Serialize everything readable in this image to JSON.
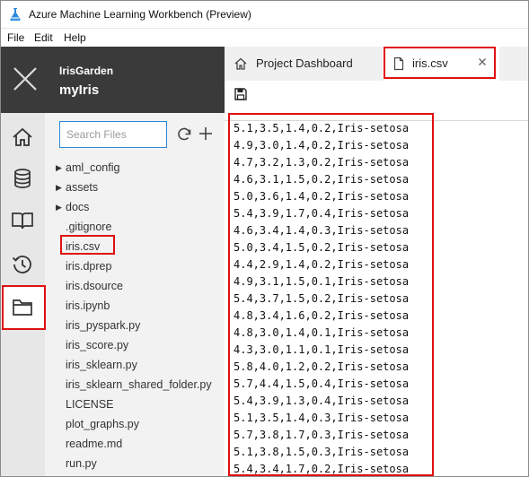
{
  "window": {
    "title": "Azure Machine Learning Workbench (Preview)",
    "app_icon": "flask-icon"
  },
  "menubar": {
    "items": [
      {
        "label": "File"
      },
      {
        "label": "Edit"
      },
      {
        "label": "Help"
      }
    ]
  },
  "project": {
    "parent": "IrisGarden",
    "name": "myIris",
    "close_icon": "close-icon"
  },
  "rail": {
    "items": [
      {
        "name": "home-icon"
      },
      {
        "name": "database-icon"
      },
      {
        "name": "notebook-icon"
      },
      {
        "name": "history-icon"
      },
      {
        "name": "folder-icon",
        "selected": true
      }
    ]
  },
  "files": {
    "search_placeholder": "Search Files",
    "items": [
      {
        "label": "aml_config",
        "folder": true
      },
      {
        "label": "assets",
        "folder": true
      },
      {
        "label": "docs",
        "folder": true
      },
      {
        "label": ".gitignore",
        "folder": false
      },
      {
        "label": "iris.csv",
        "folder": false,
        "selected": true
      },
      {
        "label": "iris.dprep",
        "folder": false
      },
      {
        "label": "iris.dsource",
        "folder": false
      },
      {
        "label": "iris.ipynb",
        "folder": false
      },
      {
        "label": "iris_pyspark.py",
        "folder": false
      },
      {
        "label": "iris_score.py",
        "folder": false
      },
      {
        "label": "iris_sklearn.py",
        "folder": false
      },
      {
        "label": "iris_sklearn_shared_folder.py",
        "folder": false
      },
      {
        "label": "LICENSE",
        "folder": false
      },
      {
        "label": "plot_graphs.py",
        "folder": false
      },
      {
        "label": "readme.md",
        "folder": false
      },
      {
        "label": "run.py",
        "folder": false
      }
    ]
  },
  "tabs": [
    {
      "label": "Project Dashboard",
      "icon": "home-icon"
    },
    {
      "label": "iris.csv",
      "icon": "file-icon",
      "active": true
    }
  ],
  "editor": {
    "lines": [
      "5.1,3.5,1.4,0.2,Iris-setosa",
      "4.9,3.0,1.4,0.2,Iris-setosa",
      "4.7,3.2,1.3,0.2,Iris-setosa",
      "4.6,3.1,1.5,0.2,Iris-setosa",
      "5.0,3.6,1.4,0.2,Iris-setosa",
      "5.4,3.9,1.7,0.4,Iris-setosa",
      "4.6,3.4,1.4,0.3,Iris-setosa",
      "5.0,3.4,1.5,0.2,Iris-setosa",
      "4.4,2.9,1.4,0.2,Iris-setosa",
      "4.9,3.1,1.5,0.1,Iris-setosa",
      "5.4,3.7,1.5,0.2,Iris-setosa",
      "4.8,3.4,1.6,0.2,Iris-setosa",
      "4.8,3.0,1.4,0.1,Iris-setosa",
      "4.3,3.0,1.1,0.1,Iris-setosa",
      "5.8,4.0,1.2,0.2,Iris-setosa",
      "5.7,4.4,1.5,0.4,Iris-setosa",
      "5.4,3.9,1.3,0.4,Iris-setosa",
      "5.1,3.5,1.4,0.3,Iris-setosa",
      "5.7,3.8,1.7,0.3,Iris-setosa",
      "5.1,3.8,1.5,0.3,Iris-setosa",
      "5.4,3.4,1.7,0.2,Iris-setosa"
    ]
  },
  "colors": {
    "highlight": "#e01010",
    "accent": "#2b88d8",
    "topbar": "#3a3a3a",
    "rail": "#e7e7e7",
    "panel": "#f2f2f2"
  }
}
